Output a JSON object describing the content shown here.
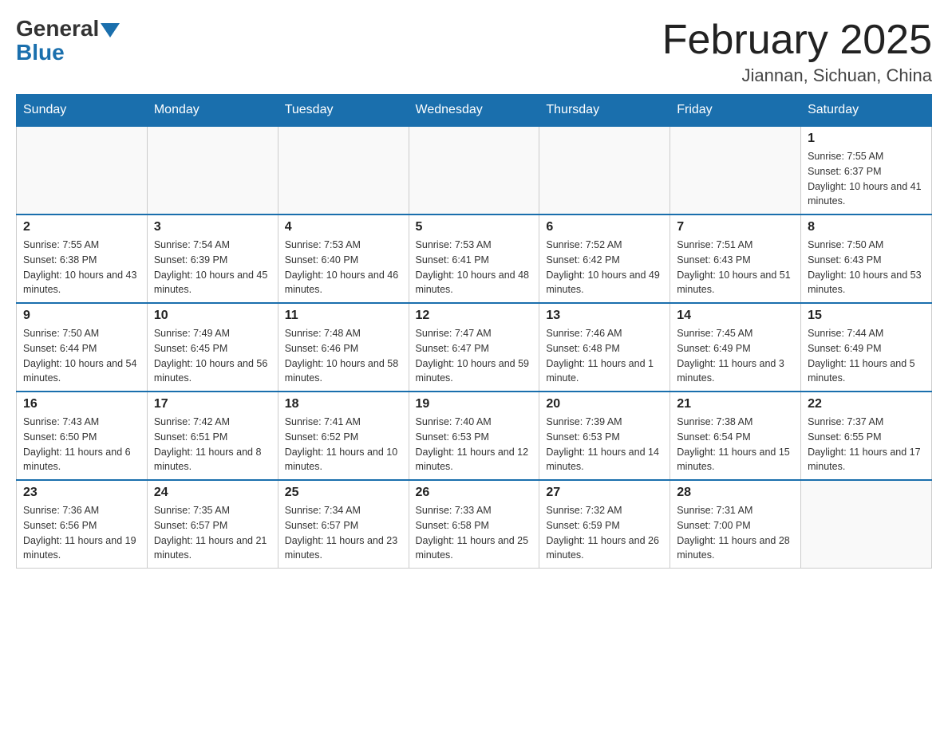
{
  "logo": {
    "general": "General",
    "blue": "Blue"
  },
  "title": "February 2025",
  "subtitle": "Jiannan, Sichuan, China",
  "days_of_week": [
    "Sunday",
    "Monday",
    "Tuesday",
    "Wednesday",
    "Thursday",
    "Friday",
    "Saturday"
  ],
  "weeks": [
    {
      "cells": [
        {
          "empty": true
        },
        {
          "empty": true
        },
        {
          "empty": true
        },
        {
          "empty": true
        },
        {
          "empty": true
        },
        {
          "empty": true
        },
        {
          "day": "1",
          "sunrise": "Sunrise: 7:55 AM",
          "sunset": "Sunset: 6:37 PM",
          "daylight": "Daylight: 10 hours and 41 minutes."
        }
      ]
    },
    {
      "cells": [
        {
          "day": "2",
          "sunrise": "Sunrise: 7:55 AM",
          "sunset": "Sunset: 6:38 PM",
          "daylight": "Daylight: 10 hours and 43 minutes."
        },
        {
          "day": "3",
          "sunrise": "Sunrise: 7:54 AM",
          "sunset": "Sunset: 6:39 PM",
          "daylight": "Daylight: 10 hours and 45 minutes."
        },
        {
          "day": "4",
          "sunrise": "Sunrise: 7:53 AM",
          "sunset": "Sunset: 6:40 PM",
          "daylight": "Daylight: 10 hours and 46 minutes."
        },
        {
          "day": "5",
          "sunrise": "Sunrise: 7:53 AM",
          "sunset": "Sunset: 6:41 PM",
          "daylight": "Daylight: 10 hours and 48 minutes."
        },
        {
          "day": "6",
          "sunrise": "Sunrise: 7:52 AM",
          "sunset": "Sunset: 6:42 PM",
          "daylight": "Daylight: 10 hours and 49 minutes."
        },
        {
          "day": "7",
          "sunrise": "Sunrise: 7:51 AM",
          "sunset": "Sunset: 6:43 PM",
          "daylight": "Daylight: 10 hours and 51 minutes."
        },
        {
          "day": "8",
          "sunrise": "Sunrise: 7:50 AM",
          "sunset": "Sunset: 6:43 PM",
          "daylight": "Daylight: 10 hours and 53 minutes."
        }
      ]
    },
    {
      "cells": [
        {
          "day": "9",
          "sunrise": "Sunrise: 7:50 AM",
          "sunset": "Sunset: 6:44 PM",
          "daylight": "Daylight: 10 hours and 54 minutes."
        },
        {
          "day": "10",
          "sunrise": "Sunrise: 7:49 AM",
          "sunset": "Sunset: 6:45 PM",
          "daylight": "Daylight: 10 hours and 56 minutes."
        },
        {
          "day": "11",
          "sunrise": "Sunrise: 7:48 AM",
          "sunset": "Sunset: 6:46 PM",
          "daylight": "Daylight: 10 hours and 58 minutes."
        },
        {
          "day": "12",
          "sunrise": "Sunrise: 7:47 AM",
          "sunset": "Sunset: 6:47 PM",
          "daylight": "Daylight: 10 hours and 59 minutes."
        },
        {
          "day": "13",
          "sunrise": "Sunrise: 7:46 AM",
          "sunset": "Sunset: 6:48 PM",
          "daylight": "Daylight: 11 hours and 1 minute."
        },
        {
          "day": "14",
          "sunrise": "Sunrise: 7:45 AM",
          "sunset": "Sunset: 6:49 PM",
          "daylight": "Daylight: 11 hours and 3 minutes."
        },
        {
          "day": "15",
          "sunrise": "Sunrise: 7:44 AM",
          "sunset": "Sunset: 6:49 PM",
          "daylight": "Daylight: 11 hours and 5 minutes."
        }
      ]
    },
    {
      "cells": [
        {
          "day": "16",
          "sunrise": "Sunrise: 7:43 AM",
          "sunset": "Sunset: 6:50 PM",
          "daylight": "Daylight: 11 hours and 6 minutes."
        },
        {
          "day": "17",
          "sunrise": "Sunrise: 7:42 AM",
          "sunset": "Sunset: 6:51 PM",
          "daylight": "Daylight: 11 hours and 8 minutes."
        },
        {
          "day": "18",
          "sunrise": "Sunrise: 7:41 AM",
          "sunset": "Sunset: 6:52 PM",
          "daylight": "Daylight: 11 hours and 10 minutes."
        },
        {
          "day": "19",
          "sunrise": "Sunrise: 7:40 AM",
          "sunset": "Sunset: 6:53 PM",
          "daylight": "Daylight: 11 hours and 12 minutes."
        },
        {
          "day": "20",
          "sunrise": "Sunrise: 7:39 AM",
          "sunset": "Sunset: 6:53 PM",
          "daylight": "Daylight: 11 hours and 14 minutes."
        },
        {
          "day": "21",
          "sunrise": "Sunrise: 7:38 AM",
          "sunset": "Sunset: 6:54 PM",
          "daylight": "Daylight: 11 hours and 15 minutes."
        },
        {
          "day": "22",
          "sunrise": "Sunrise: 7:37 AM",
          "sunset": "Sunset: 6:55 PM",
          "daylight": "Daylight: 11 hours and 17 minutes."
        }
      ]
    },
    {
      "cells": [
        {
          "day": "23",
          "sunrise": "Sunrise: 7:36 AM",
          "sunset": "Sunset: 6:56 PM",
          "daylight": "Daylight: 11 hours and 19 minutes."
        },
        {
          "day": "24",
          "sunrise": "Sunrise: 7:35 AM",
          "sunset": "Sunset: 6:57 PM",
          "daylight": "Daylight: 11 hours and 21 minutes."
        },
        {
          "day": "25",
          "sunrise": "Sunrise: 7:34 AM",
          "sunset": "Sunset: 6:57 PM",
          "daylight": "Daylight: 11 hours and 23 minutes."
        },
        {
          "day": "26",
          "sunrise": "Sunrise: 7:33 AM",
          "sunset": "Sunset: 6:58 PM",
          "daylight": "Daylight: 11 hours and 25 minutes."
        },
        {
          "day": "27",
          "sunrise": "Sunrise: 7:32 AM",
          "sunset": "Sunset: 6:59 PM",
          "daylight": "Daylight: 11 hours and 26 minutes."
        },
        {
          "day": "28",
          "sunrise": "Sunrise: 7:31 AM",
          "sunset": "Sunset: 7:00 PM",
          "daylight": "Daylight: 11 hours and 28 minutes."
        },
        {
          "empty": true
        }
      ]
    }
  ]
}
